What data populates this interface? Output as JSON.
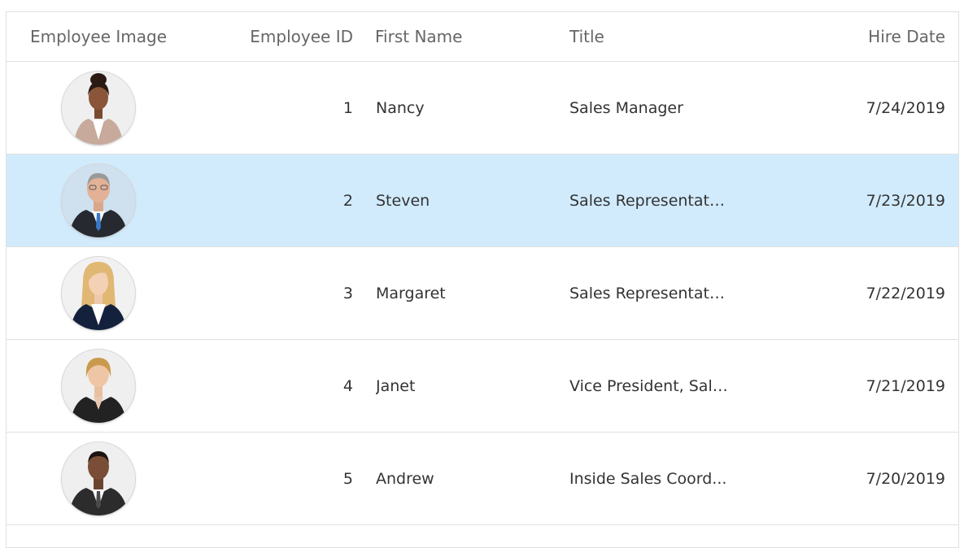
{
  "columns": {
    "image": "Employee Image",
    "id": "Employee ID",
    "first_name": "First Name",
    "title": "Title",
    "hire_date": "Hire Date"
  },
  "rows": [
    {
      "id": "1",
      "first_name": "Nancy",
      "title": "Sales Manager",
      "hire_date": "7/24/2019",
      "photo": "woman-dark-hair-beige-blazer",
      "selected": false
    },
    {
      "id": "2",
      "first_name": "Steven",
      "title": "Sales Representati...",
      "hire_date": "7/23/2019",
      "photo": "man-gray-hair-dark-suit-blue-tie",
      "selected": true
    },
    {
      "id": "3",
      "first_name": "Margaret",
      "title": "Sales Representati...",
      "hire_date": "7/22/2019",
      "photo": "woman-blonde-hair-navy-suit",
      "selected": false
    },
    {
      "id": "4",
      "first_name": "Janet",
      "title": "Vice President, Sales",
      "hire_date": "7/21/2019",
      "photo": "woman-short-blonde-hair-black-suit",
      "selected": false
    },
    {
      "id": "5",
      "first_name": "Andrew",
      "title": "Inside Sales Coord...",
      "hire_date": "7/20/2019",
      "photo": "man-dark-hair-dark-suit",
      "selected": false
    }
  ],
  "colors": {
    "selected_row": "#d1ebfd",
    "border": "#e0e0e0",
    "header_text": "#666666",
    "cell_text": "#333333"
  }
}
